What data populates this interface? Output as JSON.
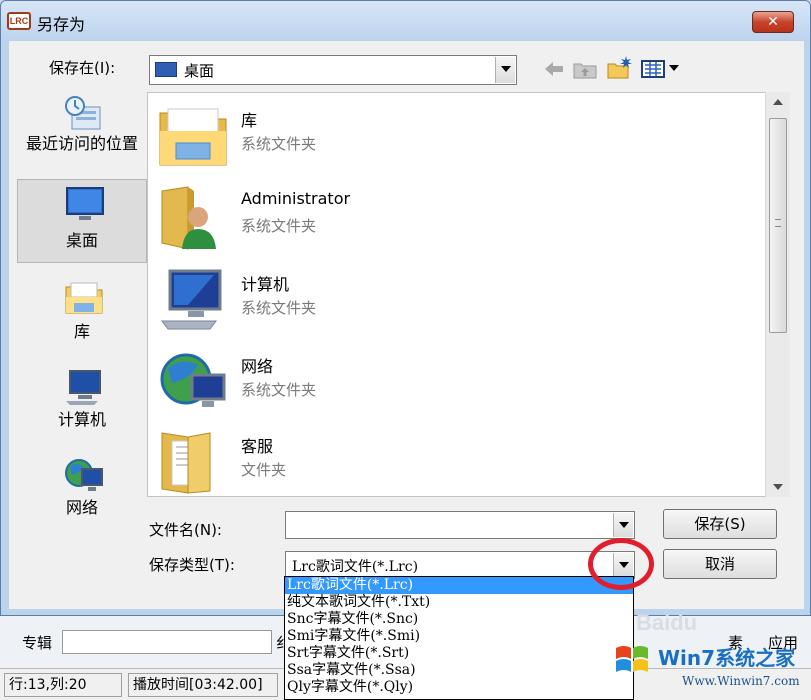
{
  "window": {
    "title": "另存为",
    "app_badge": "LRC",
    "close_glyph": "✕"
  },
  "toolbar": {
    "save_in_label": "保存在(I):",
    "location": "桌面",
    "icons": [
      "back-arrow-icon",
      "up-folder-icon",
      "new-folder-icon",
      "view-menu-icon"
    ]
  },
  "places": [
    {
      "label": "最近访问的位置",
      "icon": "recent-places-icon"
    },
    {
      "label": "桌面",
      "icon": "desktop-icon",
      "active": true
    },
    {
      "label": "库",
      "icon": "libraries-icon"
    },
    {
      "label": "计算机",
      "icon": "computer-icon"
    },
    {
      "label": "网络",
      "icon": "network-icon"
    }
  ],
  "files": [
    {
      "name": "库",
      "type": "系统文件夹",
      "icon": "libraries-folder-icon"
    },
    {
      "name": "Administrator",
      "type": "系统文件夹",
      "icon": "user-folder-icon"
    },
    {
      "name": "计算机",
      "type": "系统文件夹",
      "icon": "computer-icon"
    },
    {
      "name": "网络",
      "type": "系统文件夹",
      "icon": "network-globe-icon"
    },
    {
      "name": "客服",
      "type": "文件夹",
      "icon": "folder-icon"
    }
  ],
  "form": {
    "filename_label": "文件名(N):",
    "filename_value": "",
    "filetype_label": "保存类型(T):",
    "filetype_value": "Lrc歌词文件(*.Lrc)",
    "save_button": "保存(S)",
    "cancel_button": "取消"
  },
  "filetype_options": [
    "Lrc歌词文件(*.Lrc)",
    "纯文本歌词文件(*.Txt)",
    "Snc字幕文件(*.Snc)",
    "Smi字幕文件(*.Smi)",
    "Srt字幕文件(*.Srt)",
    "Ssa字幕文件(*.Ssa)",
    "Qly字幕文件(*.Qly)"
  ],
  "behind_window": {
    "album_label": "专辑",
    "partial_text": "纟",
    "right_partial": "素",
    "apply_label": "应用",
    "status_position": "行:13,列:20",
    "status_time": "播放时间[03:42.00]"
  },
  "watermark": {
    "brand": "Win7系统之家",
    "url": "Www.Winwin7.com",
    "baidu": "Baidu"
  },
  "colors": {
    "title_bg": "#bcd3ee",
    "close_red": "#c7442b",
    "selection_blue": "#3399ff",
    "highlight_circle": "#e01e2c"
  }
}
